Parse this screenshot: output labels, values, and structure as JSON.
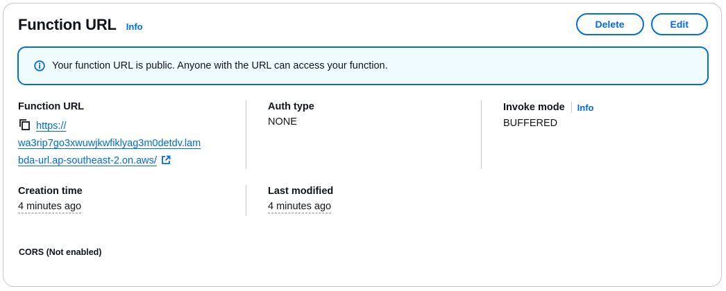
{
  "header": {
    "title": "Function URL",
    "info_label": "Info",
    "delete_label": "Delete",
    "edit_label": "Edit"
  },
  "alert": {
    "icon": "info-icon",
    "message": "Your function URL is public. Anyone with the URL can access your function."
  },
  "details": {
    "function_url": {
      "label": "Function URL",
      "url_line1": "https://",
      "url_line2": "wa3rip7go3xwuwjkwfiklyag3m0detdv.lam",
      "url_line3": "bda-url.ap-southeast-2.on.aws/"
    },
    "auth_type": {
      "label": "Auth type",
      "value": "NONE"
    },
    "invoke_mode": {
      "label": "Invoke mode",
      "info_label": "Info",
      "value": "BUFFERED"
    },
    "creation_time": {
      "label": "Creation time",
      "value": "4 minutes ago"
    },
    "last_modified": {
      "label": "Last modified",
      "value": "4 minutes ago"
    }
  },
  "cors": {
    "label": "CORS (Not enabled)"
  },
  "colors": {
    "accent": "#006ce0",
    "alert_bg": "#f0fbff",
    "border": "#c6c6cd"
  }
}
